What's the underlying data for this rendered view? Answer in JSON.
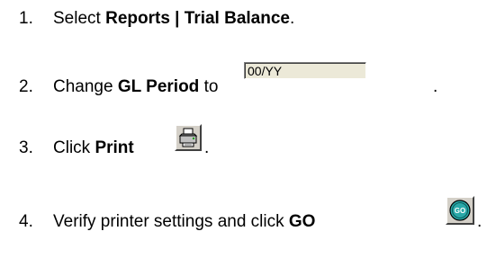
{
  "steps": [
    {
      "number": "1.",
      "text_before": "Select ",
      "bold": "Reports | Trial Balance",
      "text_after": "."
    },
    {
      "number": "2.",
      "text_before": "Change ",
      "bold": "GL Period",
      "text_after": " to",
      "field_value": "00/YY",
      "trailing": "."
    },
    {
      "number": "3.",
      "text_before": "Click ",
      "bold": "Print",
      "trailing": ".",
      "icon": "printer-icon"
    },
    {
      "number": "4.",
      "text_before": "Verify printer settings and click ",
      "bold": "GO",
      "trailing": ".",
      "icon": "go-icon",
      "icon_label": "GO"
    }
  ],
  "colors": {
    "field_bg": "#ece9d8",
    "button_face": "#d4d0c8",
    "go_circle": "#20a0a0"
  }
}
